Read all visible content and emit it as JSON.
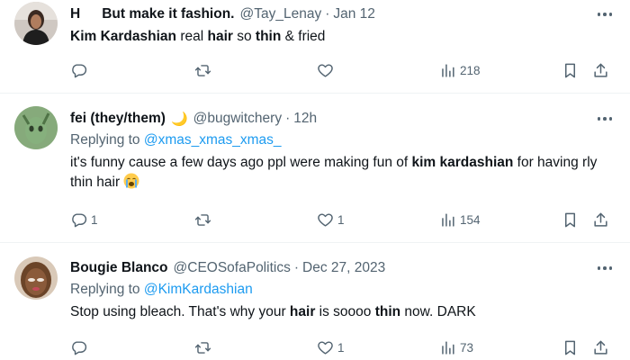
{
  "colors": {
    "text": "#0f1419",
    "secondary": "#536471",
    "link": "#1d9bf0",
    "divider": "#eff3f4"
  },
  "tweets": [
    {
      "name": "H",
      "name_suffix": "But make it fashion.",
      "handle": "@Tay_Lenay",
      "dot": "·",
      "time": "Jan 12",
      "text": {
        "p1": "Kim Kardashian",
        "p2": " real ",
        "p3": "hair",
        "p4": " so ",
        "p5": "thin",
        "p6": " & fried"
      },
      "replies": "",
      "retweets": "",
      "likes": "",
      "views": "218"
    },
    {
      "name": "fei (they/them)",
      "name_emoji": "🌙",
      "handle": "@bugwitchery",
      "dot": "·",
      "time": "12h",
      "replying_prefix": "Replying to ",
      "replying_to": "@xmas_xmas_xmas_",
      "text": {
        "p1": "it's funny cause a few days ago ppl were making fun of ",
        "p2": "kim kardashian",
        "p3": " for having rly thin hair "
      },
      "emoji": "loudly-crying-face-emoji",
      "replies": "1",
      "retweets": "",
      "likes": "1",
      "views": "154"
    },
    {
      "name": "Bougie Blanco",
      "handle": "@CEOSofaPolitics",
      "dot": "·",
      "time": "Dec 27, 2023",
      "replying_prefix": "Replying to ",
      "replying_to": "@KimKardashian",
      "text": {
        "p1": "Stop using bleach.  That's why your ",
        "p2": "hair",
        "p3": " is soooo ",
        "p4": "thin",
        "p5": " now.  DARK"
      },
      "replies": "",
      "retweets": "",
      "likes": "1",
      "views": "73"
    }
  ]
}
